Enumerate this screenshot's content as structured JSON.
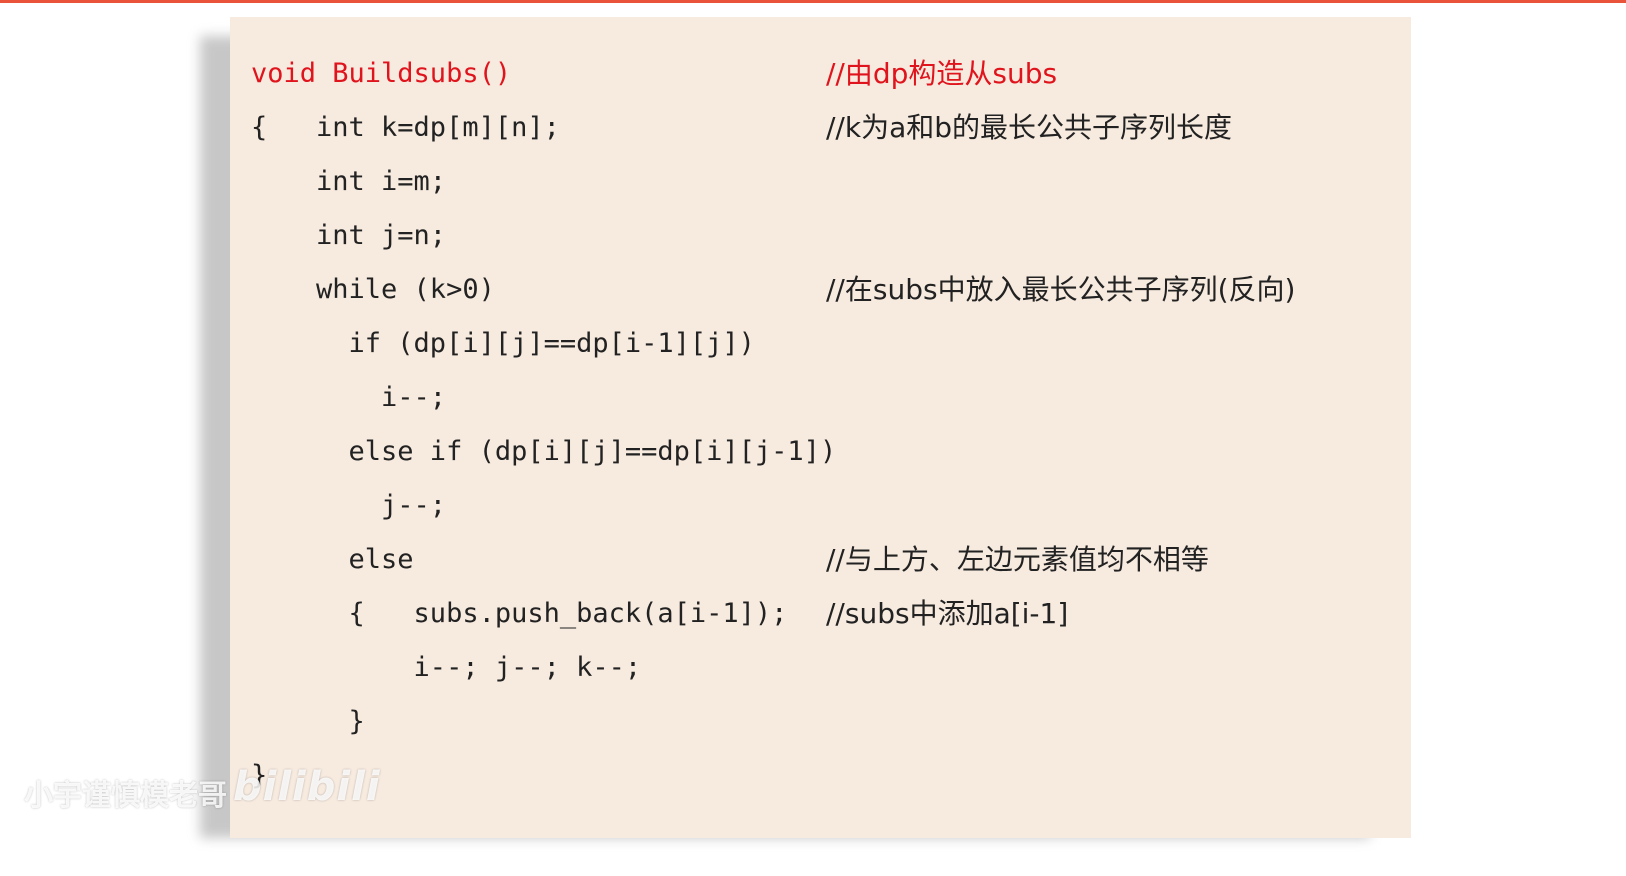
{
  "slide": {
    "lines": [
      {
        "code": "void Buildsubs()",
        "comment": "//由dp构造从subs",
        "red": true
      },
      {
        "code": "{   int k=dp[m][n];",
        "comment": "//k为a和b的最长公共子序列长度"
      },
      {
        "code": "    int i=m;",
        "comment": ""
      },
      {
        "code": "    int j=n;",
        "comment": ""
      },
      {
        "code": "    while (k>0)",
        "comment": "//在subs中放入最长公共子序列(反向)"
      },
      {
        "code": "      if (dp[i][j]==dp[i-1][j])",
        "comment": ""
      },
      {
        "code": "        i--;",
        "comment": ""
      },
      {
        "code": "      else if (dp[i][j]==dp[i][j-1])",
        "comment": ""
      },
      {
        "code": "        j--;",
        "comment": ""
      },
      {
        "code": "      else",
        "comment": "//与上方、左边元素值均不相等"
      },
      {
        "code": "      {   subs.push_back(a[i-1]);",
        "comment": "//subs中添加a[i-1]"
      },
      {
        "code": "          i--; j--; k--;",
        "comment": ""
      },
      {
        "code": "      }",
        "comment": ""
      },
      {
        "code": "}",
        "comment": ""
      }
    ]
  },
  "watermark": {
    "author": "小宇谨慎模老哥",
    "logo": "bilibili"
  },
  "colors": {
    "accent_rule": "#e8533a",
    "slide_bg": "#f7eadf",
    "keyword_red": "#e0141c",
    "text": "#222222"
  }
}
